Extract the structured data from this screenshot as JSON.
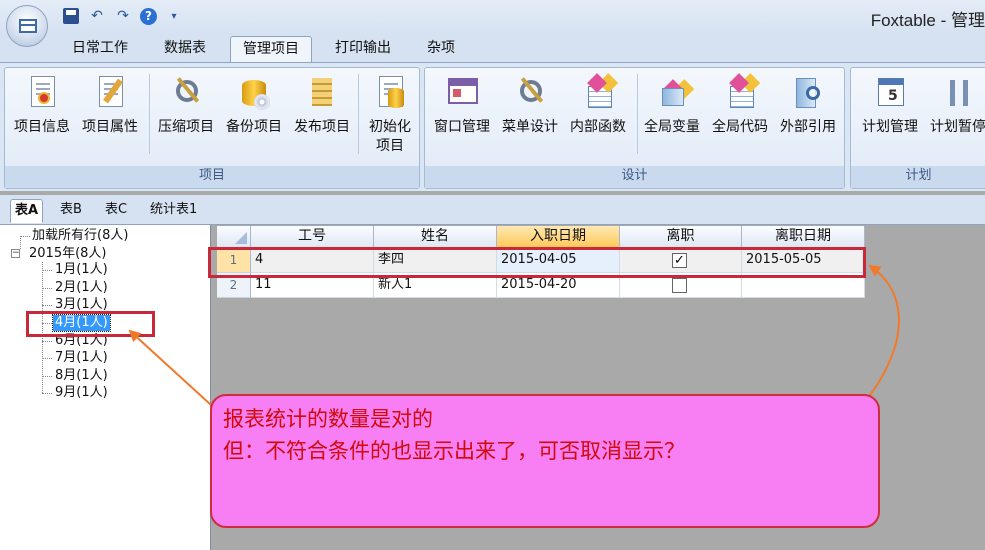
{
  "window": {
    "title": "Foxtable - 管理"
  },
  "quick_access": [
    {
      "icon": "save-icon"
    },
    {
      "icon": "undo-icon"
    },
    {
      "icon": "redo-icon"
    },
    {
      "icon": "help-icon"
    }
  ],
  "ribbon_tabs": [
    "日常工作",
    "数据表",
    "管理项目",
    "打印输出",
    "杂项"
  ],
  "ribbon_active_tab": "管理项目",
  "ribbon_groups": {
    "project": {
      "label": "项目",
      "buttons": [
        {
          "label": "项目信息",
          "icon": "project-info-icon"
        },
        {
          "label": "项目属性",
          "icon": "project-properties-icon"
        },
        {
          "label": "压缩项目",
          "icon": "compress-project-icon"
        },
        {
          "label": "备份项目",
          "icon": "backup-project-icon"
        },
        {
          "label": "发布项目",
          "icon": "publish-project-icon"
        },
        {
          "label": "初始化项目",
          "line1": "初始化",
          "line2": "项目",
          "icon": "init-project-icon"
        }
      ]
    },
    "design": {
      "label": "设计",
      "buttons": [
        {
          "label": "窗口管理",
          "icon": "window-manager-icon"
        },
        {
          "label": "菜单设计",
          "icon": "menu-design-icon"
        },
        {
          "label": "内部函数",
          "icon": "internal-functions-icon"
        },
        {
          "label": "全局变量",
          "icon": "global-variables-icon"
        },
        {
          "label": "全局代码",
          "icon": "global-code-icon"
        },
        {
          "label": "外部引用",
          "icon": "external-references-icon"
        }
      ]
    },
    "plan": {
      "label": "计划",
      "buttons": [
        {
          "label": "计划管理",
          "icon": "plan-manager-icon",
          "glyph": "5"
        },
        {
          "label": "计划暂停",
          "icon": "plan-pause-icon"
        }
      ]
    }
  },
  "doc_tabs": [
    "表A",
    "表B",
    "表C",
    "统计表1"
  ],
  "doc_active_tab": "表A",
  "tree": {
    "root_load_all": "加载所有行(8人)",
    "year_node": "2015年(8人)",
    "months": [
      "1月(1人)",
      "2月(1人)",
      "3月(1人)",
      "4月(1人)",
      "6月(1人)",
      "7月(1人)",
      "8月(1人)",
      "9月(1人)"
    ],
    "selected": "4月(1人)"
  },
  "table": {
    "columns": [
      "工号",
      "姓名",
      "入职日期",
      "离职",
      "离职日期"
    ],
    "sorted_column": "入职日期",
    "rows": [
      {
        "num": "1",
        "id": "4",
        "name": "李四",
        "hire_date": "2015-04-05",
        "resigned": true,
        "resign_date": "2015-05-05"
      },
      {
        "num": "2",
        "id": "11",
        "name": "新人1",
        "hire_date": "2015-04-20",
        "resigned": false,
        "resign_date": ""
      }
    ]
  },
  "annotation": {
    "line1": "报表统计的数量是对的",
    "line2": "但：不符合条件的也显示出来了，可否取消显示？",
    "box_color": "#f77ff3",
    "border_color": "#d22b3c",
    "text_color": "#d10a0a",
    "arrow_color": "#f07a2a"
  },
  "colors": {
    "ribbon_bg": "#dbe6f4",
    "selection_blue": "#3399ff",
    "sorted_header": "#ffc95a"
  }
}
